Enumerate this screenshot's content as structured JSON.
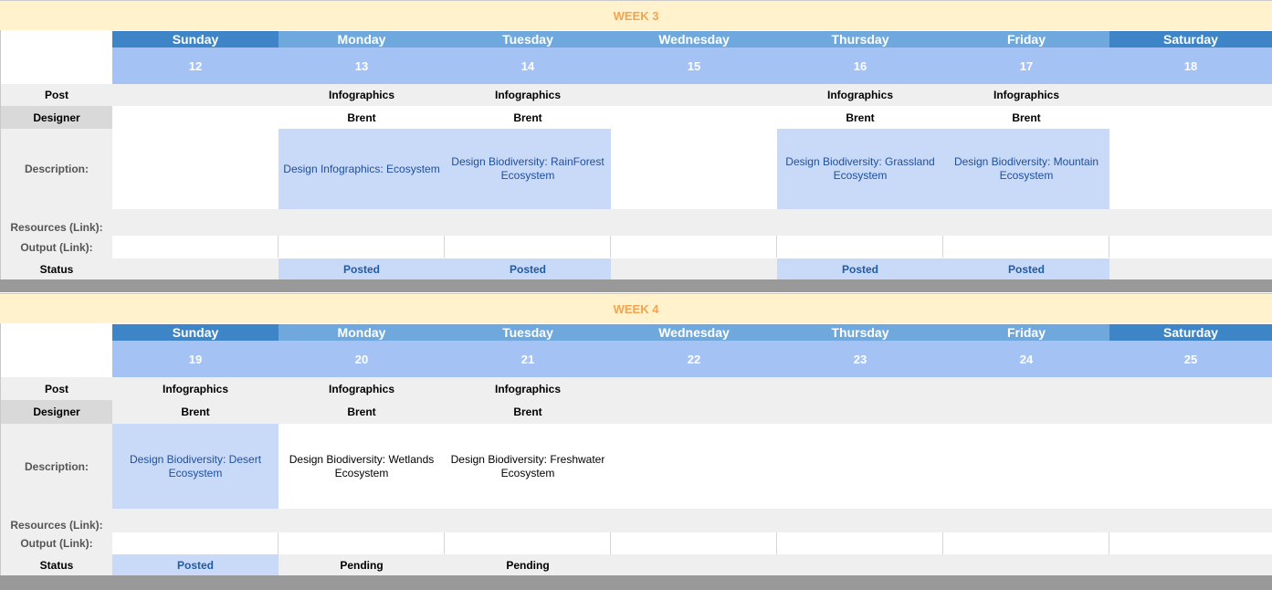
{
  "weeks": [
    {
      "title": "WEEK 3",
      "days": [
        {
          "name": "Sunday",
          "num": "12"
        },
        {
          "name": "Monday",
          "num": "13"
        },
        {
          "name": "Tuesday",
          "num": "14"
        },
        {
          "name": "Wednesday",
          "num": "15"
        },
        {
          "name": "Thursday",
          "num": "16"
        },
        {
          "name": "Friday",
          "num": "17"
        },
        {
          "name": "Saturday",
          "num": "18"
        }
      ],
      "labels": {
        "post": "Post",
        "designer": "Designer",
        "description": "Description:",
        "resources": "Resources (Link):",
        "output": "Output (Link):",
        "status": "Status"
      },
      "post": [
        "",
        "Infographics",
        "Infographics",
        "",
        "Infographics",
        "Infographics",
        ""
      ],
      "designer": [
        "",
        "Brent",
        "Brent",
        "",
        "Brent",
        "Brent",
        ""
      ],
      "description": [
        "",
        "Design Infographics: Ecosystem",
        "Design Biodiversity: RainForest Ecosystem",
        "",
        "Design Biodiversity: Grassland Ecosystem",
        "Design Biodiversity: Mountain Ecosystem",
        ""
      ],
      "status": [
        "",
        "Posted",
        "Posted",
        "",
        "Posted",
        "Posted",
        ""
      ]
    },
    {
      "title": "WEEK 4",
      "days": [
        {
          "name": "Sunday",
          "num": "19"
        },
        {
          "name": "Monday",
          "num": "20"
        },
        {
          "name": "Tuesday",
          "num": "21"
        },
        {
          "name": "Wednesday",
          "num": "22"
        },
        {
          "name": "Thursday",
          "num": "23"
        },
        {
          "name": "Friday",
          "num": "24"
        },
        {
          "name": "Saturday",
          "num": "25"
        }
      ],
      "labels": {
        "post": "Post",
        "designer": "Designer",
        "description": "Description:",
        "resources": "Resources (Link):",
        "output": "Output (Link):",
        "status": "Status"
      },
      "post": [
        "Infographics",
        "Infographics",
        "Infographics",
        "",
        "",
        "",
        ""
      ],
      "designer": [
        "Brent",
        "Brent",
        "Brent",
        "",
        "",
        "",
        ""
      ],
      "description": [
        "Design Biodiversity: Desert Ecosystem",
        "Design Biodiversity: Wetlands Ecosystem",
        "Design Biodiversity: Freshwater Ecosystem",
        "",
        "",
        "",
        ""
      ],
      "status": [
        "Posted",
        "Pending",
        "Pending",
        "",
        "",
        "",
        ""
      ]
    }
  ],
  "colors": {
    "week_title_bg": "#fff2cc",
    "week_title_text": "#f4a450",
    "day_header_dark": "#3d85c6",
    "day_header_light": "#6fa8dc",
    "day_number_bg": "#a4c2f4",
    "highlight_cell": "#c9daf8",
    "separator": "#999999"
  }
}
